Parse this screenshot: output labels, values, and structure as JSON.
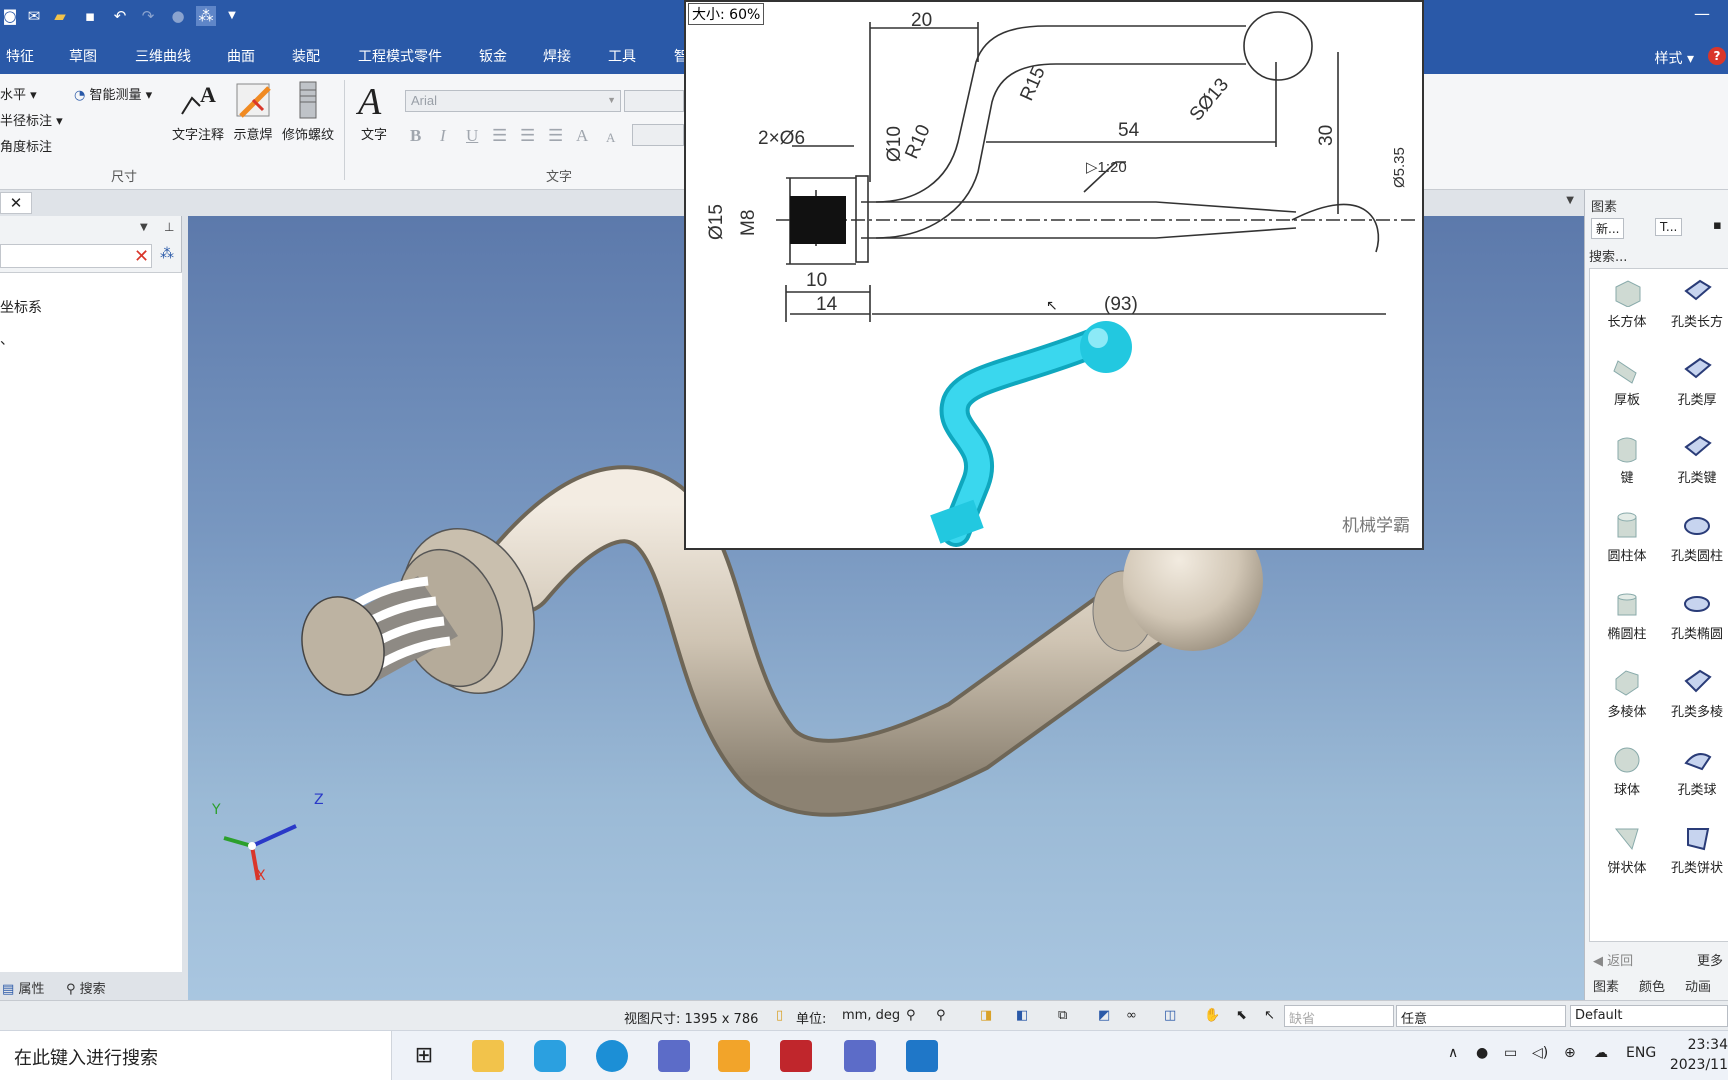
{
  "menu": {
    "items": [
      "特征",
      "草图",
      "三维曲线",
      "曲面",
      "装配",
      "工程模式零件",
      "钣金",
      "焊接",
      "工具",
      "智"
    ],
    "style": "样式",
    "help": "?"
  },
  "ribbon": {
    "dim_small": [
      "水平",
      "半径标注",
      "角度标注"
    ],
    "smart_measure": "智能测量",
    "text_annotation": "文字注释",
    "weld_symbol": "示意焊",
    "thread": "修饰螺纹",
    "text_tool": "文字",
    "font": "Arial",
    "group_dimension": "尺寸",
    "group_text": "文字",
    "format_buttons": [
      "B",
      "I",
      "U",
      "A",
      "A"
    ]
  },
  "left_panel": {
    "tree_items": [
      "坐标系",
      "、"
    ],
    "tab_properties": "属性",
    "tab_search": "搜索"
  },
  "image_window": {
    "zoom": "大小: 60%",
    "dims": [
      "20",
      "R15",
      "SØ13",
      "54",
      "30",
      "Ø10",
      "R10",
      "2×Ø6",
      "▷1:20",
      "Ø5.35",
      "Ø15",
      "M8",
      "10",
      "14",
      "(93)"
    ],
    "watermark": "机械学霸"
  },
  "right_panel": {
    "title": "图素",
    "tabs": [
      "新...",
      "T..."
    ],
    "search_label": "搜索...",
    "shapes_left": [
      "长方体",
      "厚板",
      "键",
      "圆柱体",
      "椭圆柱",
      "多棱体",
      "球体",
      "饼状体"
    ],
    "shapes_right": [
      "孔类长方",
      "孔类厚",
      "孔类键",
      "孔类圆柱",
      "孔类椭圆",
      "孔类多棱",
      "孔类球",
      "孔类饼状"
    ],
    "back": "返回",
    "more": "更多",
    "bottom_tabs": [
      "图素",
      "颜色",
      "动画"
    ]
  },
  "axes": {
    "x": "X",
    "y": "Y",
    "z": "Z"
  },
  "status": {
    "view_size": "视图尺寸: 1395 x  786",
    "unit_label": "单位:",
    "unit_value": "mm, deg",
    "default_combo": "缺省",
    "any_combo": "任意",
    "style_combo": "Default"
  },
  "taskbar": {
    "search_placeholder": "在此键入进行搜索",
    "lang": "ENG",
    "time": "23:34",
    "date": "2023/11"
  },
  "colors": {
    "title_blue": "#2a59a8",
    "part_beige": "#d6cbbb",
    "drawing_cyan": "#1fc4dc"
  }
}
